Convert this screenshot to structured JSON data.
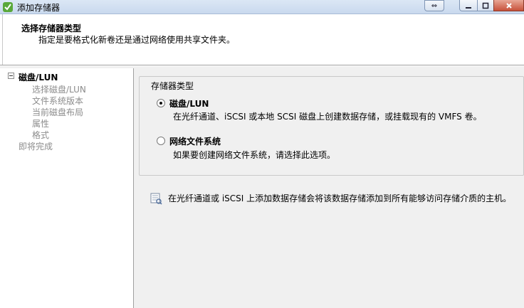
{
  "window": {
    "title": "添加存储器"
  },
  "header": {
    "title": "选择存储器类型",
    "subtitle": "指定是要格式化新卷还是通过网络使用共享文件夹。"
  },
  "nav": {
    "root": "磁盘/LUN",
    "items": [
      "选择磁盘/LUN",
      "文件系统版本",
      "当前磁盘布局",
      "属性",
      "格式"
    ],
    "finish": "即将完成"
  },
  "storage_type": {
    "legend": "存储器类型",
    "options": [
      {
        "label": "磁盘/LUN",
        "description": "在光纤通道、iSCSI 或本地 SCSI 磁盘上创建数据存储，或挂载现有的 VMFS 卷。",
        "selected": true
      },
      {
        "label": "网络文件系统",
        "description": "如果要创建网络文件系统，请选择此选项。",
        "selected": false
      }
    ]
  },
  "info": {
    "text": "在光纤通道或 iSCSI 上添加数据存储会将该数据存储添加到所有能够访问存储介质的主机。",
    "icon": "info-note-icon"
  },
  "colors": {
    "titlebar": "#c9d9ee",
    "close_button": "#c7513a",
    "disabled_text": "#8c8c8c"
  }
}
